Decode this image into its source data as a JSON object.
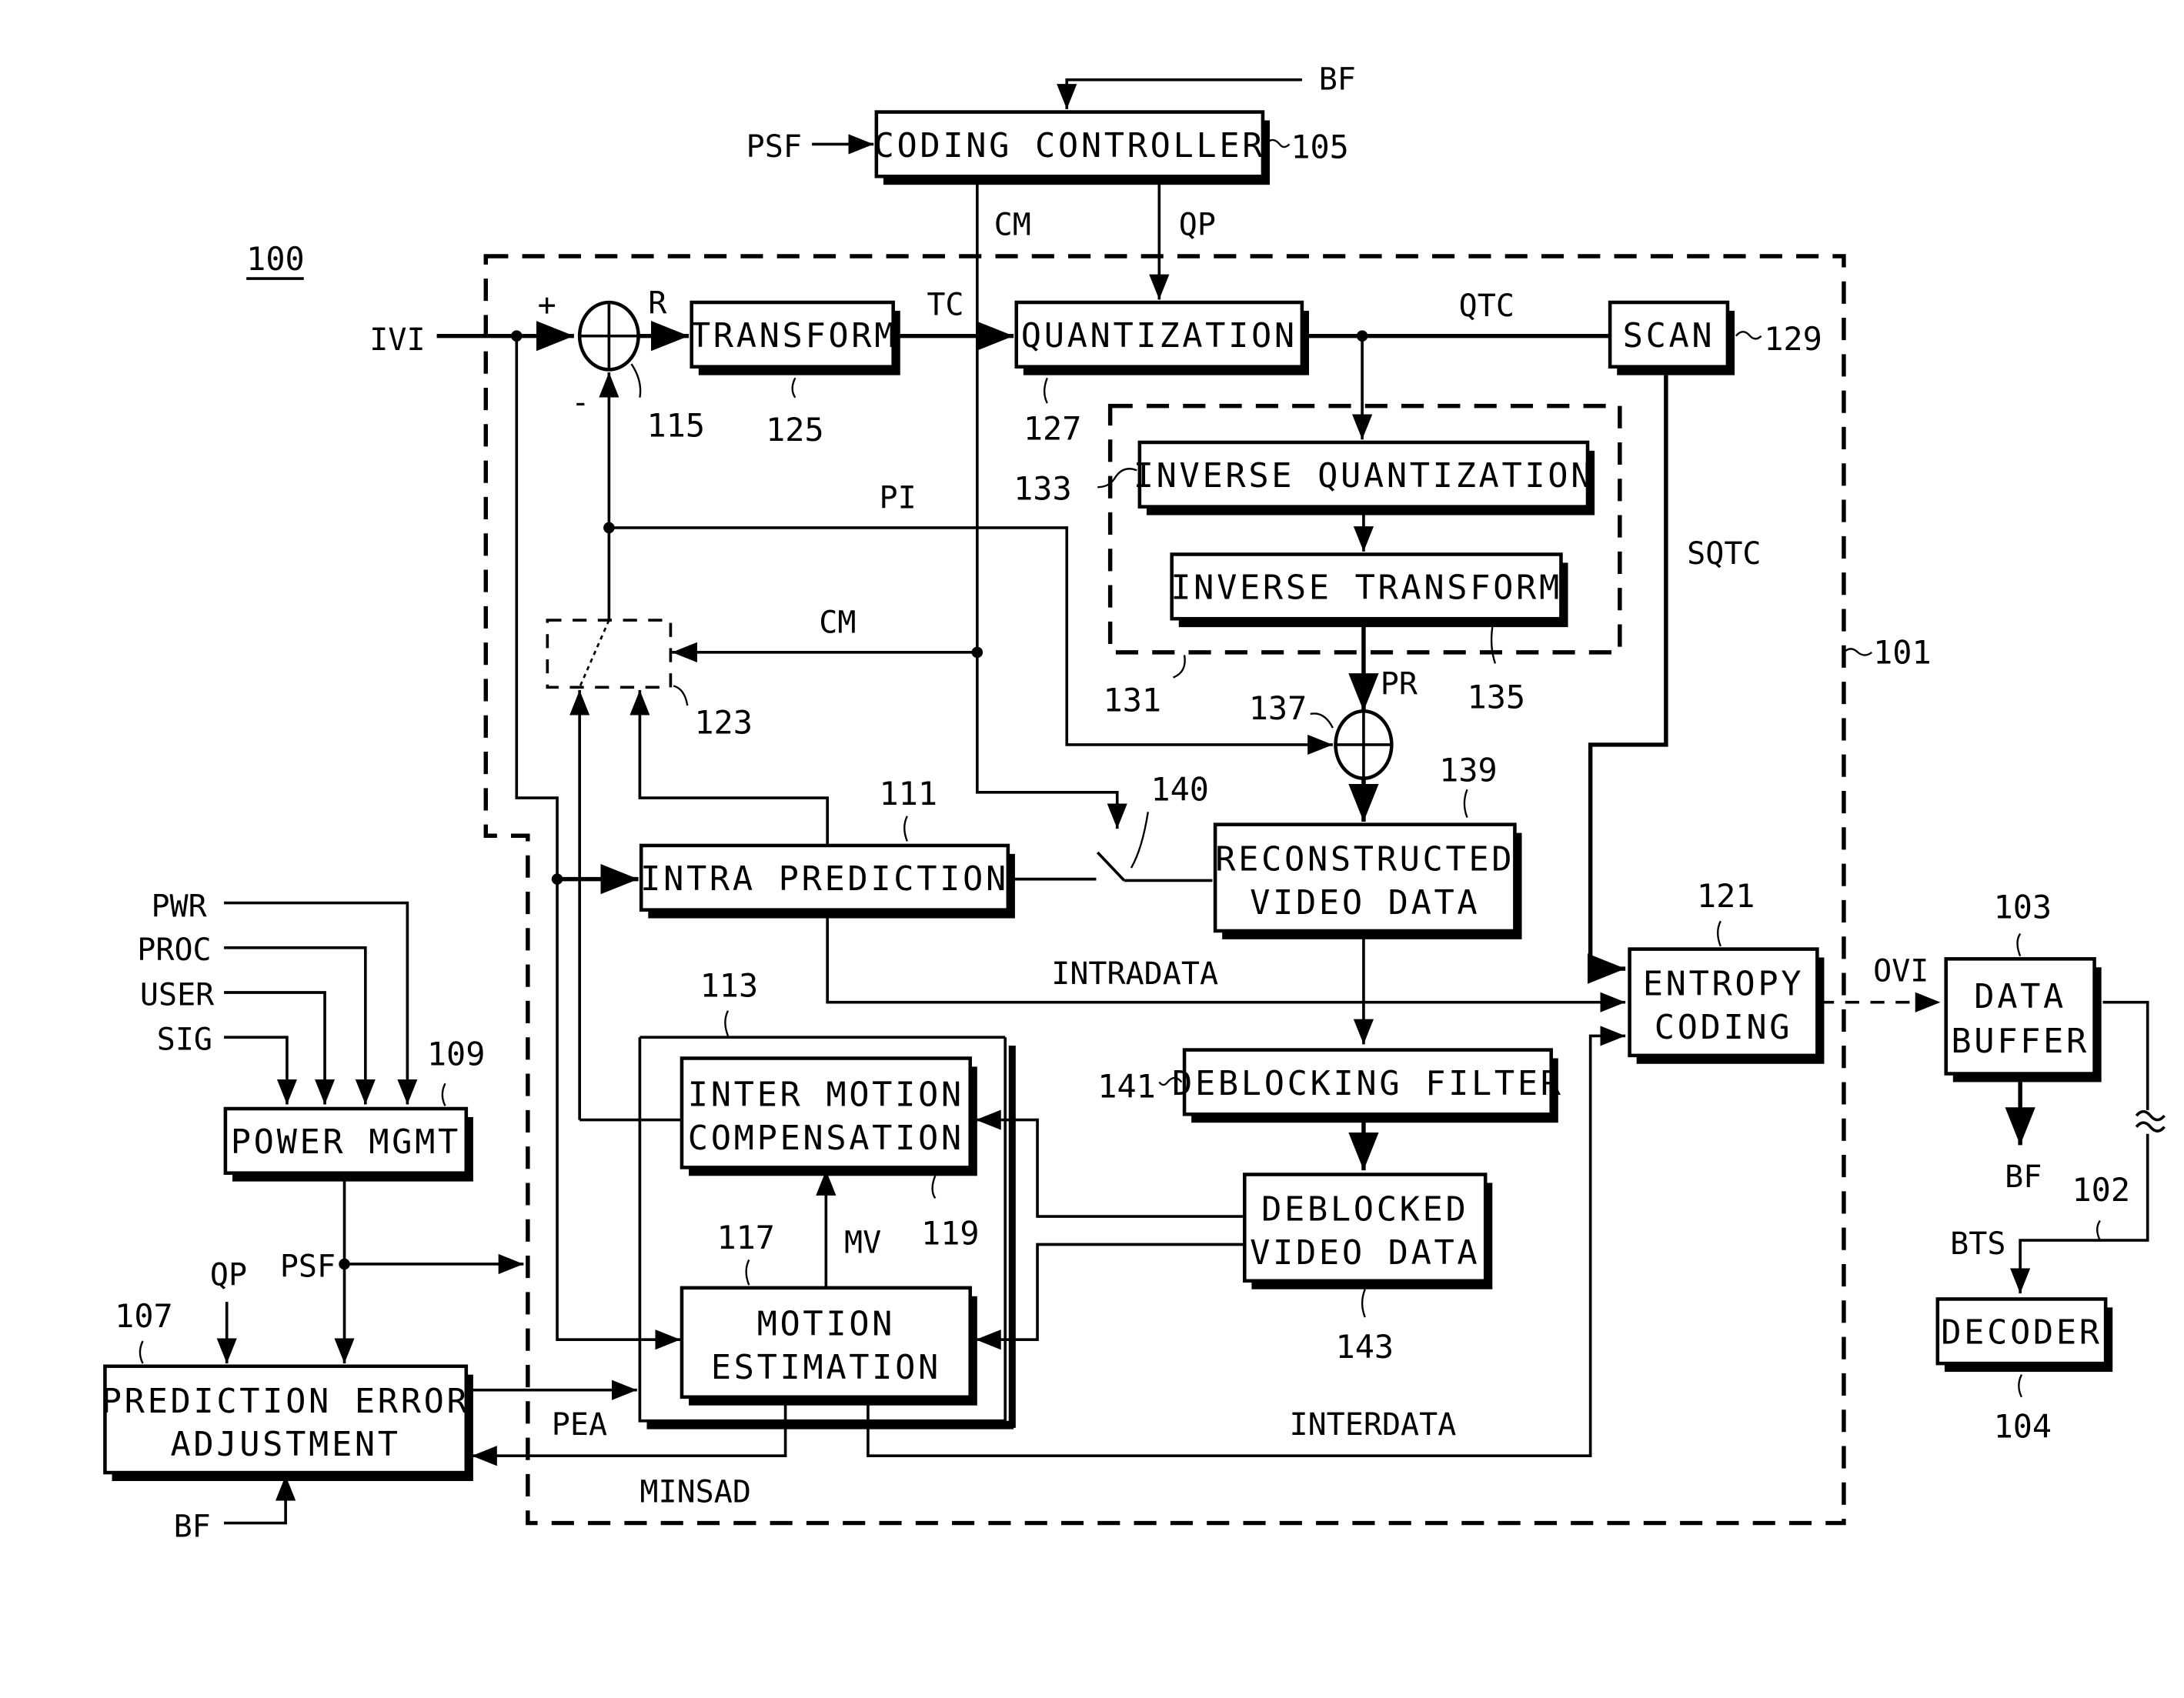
{
  "figure": {
    "ref": "100",
    "encoder_ref": "101",
    "blocks": {
      "coding_controller": {
        "label": "CODING CONTROLLER",
        "ref": "105"
      },
      "transform": {
        "label": "TRANSFORM",
        "ref": "125"
      },
      "quantization": {
        "label": "QUANTIZATION",
        "ref": "127"
      },
      "scan": {
        "label": "SCAN",
        "ref": "129"
      },
      "inverse_quantization": {
        "label": "INVERSE QUANTIZATION",
        "ref": "133"
      },
      "inverse_transform": {
        "label": "INVERSE TRANSFORM",
        "ref": "135"
      },
      "inverse_group": {
        "ref": "131"
      },
      "adder_115": {
        "ref": "115"
      },
      "adder_137": {
        "ref": "137"
      },
      "mode_switch": {
        "ref": "123"
      },
      "switch_140": {
        "ref": "140"
      },
      "intra_prediction": {
        "label": "INTRA PREDICTION",
        "ref": "111"
      },
      "reconstructed": {
        "line1": "RECONSTRUCTED",
        "line2": "VIDEO DATA",
        "ref": "139"
      },
      "inter_group": {
        "ref": "113"
      },
      "inter_mc": {
        "line1": "INTER MOTION",
        "line2": "COMPENSATION",
        "ref": "119"
      },
      "motion_estimation": {
        "line1": "MOTION",
        "line2": "ESTIMATION",
        "ref": "117"
      },
      "deblocking_filter": {
        "label": "DEBLOCKING FILTER",
        "ref": "141"
      },
      "deblocked": {
        "line1": "DEBLOCKED",
        "line2": "VIDEO DATA",
        "ref": "143"
      },
      "entropy": {
        "line1": "ENTROPY",
        "line2": "CODING",
        "ref": "121"
      },
      "data_buffer": {
        "line1": "DATA",
        "line2": "BUFFER",
        "ref": "103"
      },
      "decoder": {
        "label": "DECODER",
        "ref": "104"
      },
      "channel": {
        "ref": "102"
      },
      "power_mgmt": {
        "label": "POWER MGMT",
        "ref": "109"
      },
      "pred_err_adj": {
        "line1": "PREDICTION ERROR",
        "line2": "ADJUSTMENT",
        "ref": "107"
      }
    },
    "signals": {
      "bf_top": "BF",
      "psf_top": "PSF",
      "cm_top": "CM",
      "qp_top": "QP",
      "ivi": "IVI",
      "plus": "+",
      "minus": "-",
      "r": "R",
      "tc": "TC",
      "qtc": "QTC",
      "pi": "PI",
      "cm_mid": "CM",
      "sqtc": "SQTC",
      "pr": "PR",
      "intradata": "INTRADATA",
      "interdata": "INTERDATA",
      "mv": "MV",
      "ovi": "OVI",
      "bf_buf": "BF",
      "bts": "BTS",
      "pwr": "PWR",
      "proc": "PROC",
      "user": "USER",
      "sig": "SIG",
      "psf_pm": "PSF",
      "qp_pea": "QP",
      "pea": "PEA",
      "minsad": "MINSAD",
      "bf_pea": "BF"
    }
  }
}
